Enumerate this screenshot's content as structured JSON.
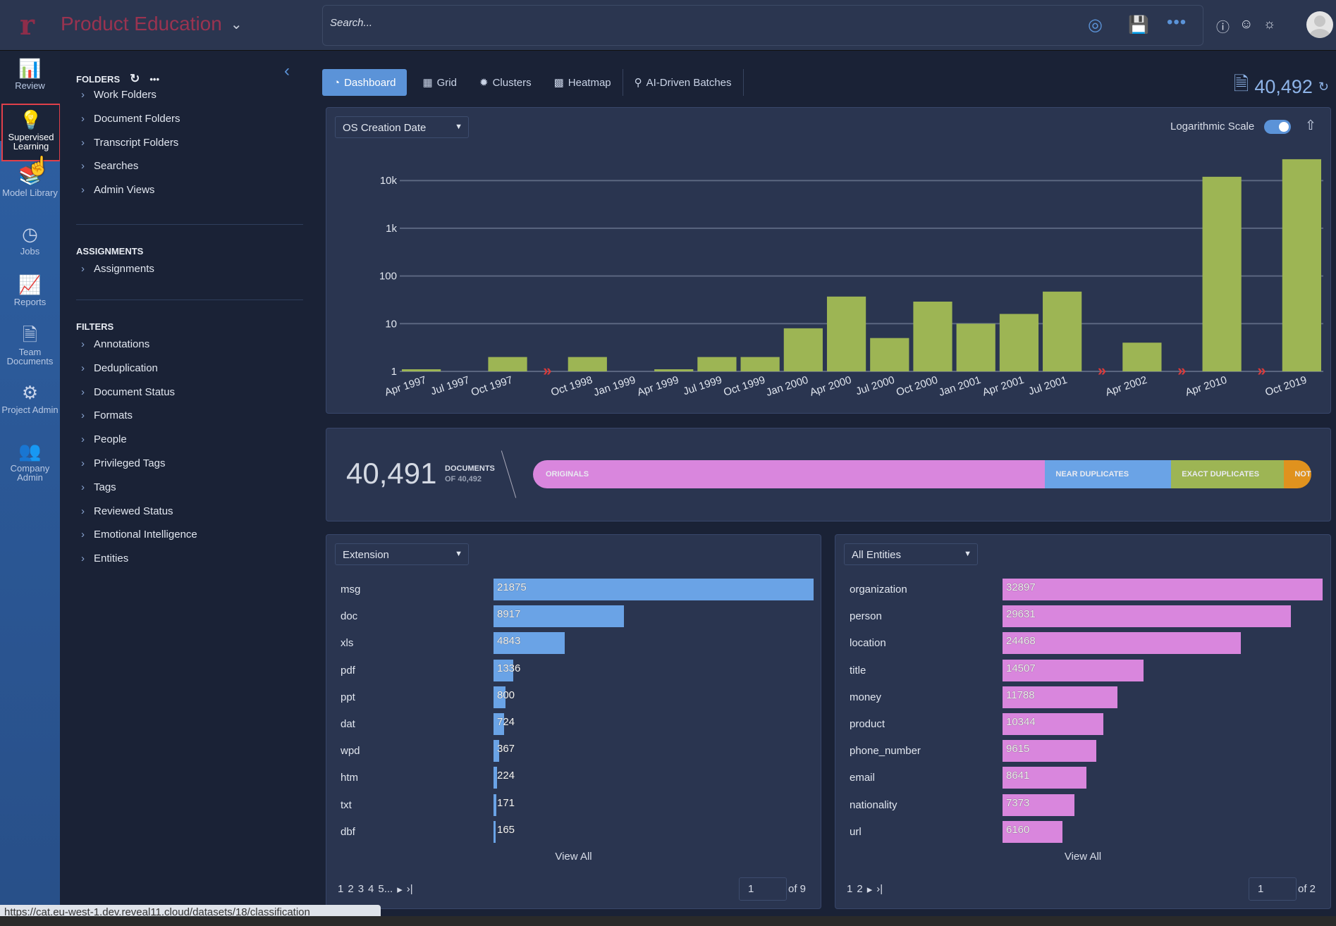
{
  "header": {
    "logo": "r",
    "project": "Product Education",
    "search_placeholder": "Search...",
    "icons": [
      "target-icon",
      "save-icon",
      "more-icon",
      "help-icon",
      "support-icon",
      "brightness-icon",
      "avatar"
    ]
  },
  "rail": [
    {
      "label": "Review",
      "icon": "bar-chart-icon"
    },
    {
      "label": "Supervised Learning",
      "icon": "lightbulb-icon",
      "selected": true
    },
    {
      "label": "Model Library",
      "icon": "library-icon"
    },
    {
      "label": "Jobs",
      "icon": "clock-icon"
    },
    {
      "label": "Reports",
      "icon": "line-chart-icon"
    },
    {
      "label": "Team Documents",
      "icon": "document-icon"
    },
    {
      "label": "Project Admin",
      "icon": "gear-icon"
    },
    {
      "label": "Company Admin",
      "icon": "users-icon"
    }
  ],
  "panel": {
    "folders_title": "FOLDERS",
    "folders": [
      "Work Folders",
      "Document Folders",
      "Transcript Folders",
      "Searches",
      "Admin Views"
    ],
    "assignments_title": "ASSIGNMENTS",
    "assignments": [
      "Assignments"
    ],
    "filters_title": "FILTERS",
    "filters": [
      "Annotations",
      "Deduplication",
      "Document Status",
      "Formats",
      "People",
      "Privileged Tags",
      "Tags",
      "Reviewed Status",
      "Emotional Intelligence",
      "Entities"
    ]
  },
  "tabs": [
    {
      "label": "Dashboard",
      "icon": "gauge-icon",
      "active": true
    },
    {
      "label": "Grid",
      "icon": "grid-icon"
    },
    {
      "label": "Clusters",
      "icon": "clusters-icon"
    },
    {
      "label": "Heatmap",
      "icon": "heatmap-icon"
    },
    {
      "label": "AI-Driven Batches",
      "icon": "bulb-icon"
    }
  ],
  "total_docs": "40,492",
  "timeline": {
    "dropdown": "OS Creation Date",
    "log_label": "Logarithmic Scale",
    "log_enabled": true
  },
  "chart_data": {
    "type": "bar",
    "yscale": "log",
    "ylim": [
      1,
      30000
    ],
    "yticks": [
      "1",
      "10",
      "100",
      "1k",
      "10k"
    ],
    "color": "#9db554",
    "break_color": "#d83a3a",
    "categories": [
      "Apr 1997",
      "Jul 1997",
      "Oct 1997",
      "|",
      "Oct 1998",
      "Jan 1999",
      "Apr 1999",
      "Jul 1999",
      "Oct 1999",
      "Jan 2000",
      "Apr 2000",
      "Jul 2000",
      "Oct 2000",
      "Jan 2001",
      "Apr 2001",
      "Jul 2001",
      "|",
      "Apr 2002",
      "|",
      "Apr 2010",
      "|",
      "Oct 2019"
    ],
    "values": [
      1,
      0,
      2,
      null,
      2,
      0,
      1,
      2,
      2,
      8,
      37,
      5,
      29,
      10,
      16,
      47,
      null,
      4,
      null,
      12000,
      null,
      28000
    ]
  },
  "dedupe": {
    "count": "40,491",
    "label": "DOCUMENTS",
    "of": "OF 40,492",
    "segments": [
      {
        "label": "ORIGINALS",
        "share": 0.648,
        "color": "#d986dd"
      },
      {
        "label": "NEAR DUPLICATES",
        "share": 0.162,
        "color": "#6aa3e6"
      },
      {
        "label": "EXACT DUPLICATES",
        "share": 0.145,
        "color": "#9db554"
      },
      {
        "label": "NOT",
        "share": 0.045,
        "color": "#e0921e"
      }
    ]
  },
  "extension": {
    "dropdown": "Extension",
    "color": "#6aa3e6",
    "max": 21875,
    "rows": [
      {
        "label": "msg",
        "value": 21875
      },
      {
        "label": "doc",
        "value": 8917
      },
      {
        "label": "xls",
        "value": 4843
      },
      {
        "label": "pdf",
        "value": 1336
      },
      {
        "label": "ppt",
        "value": 800
      },
      {
        "label": "dat",
        "value": 724
      },
      {
        "label": "wpd",
        "value": 367
      },
      {
        "label": "htm",
        "value": 224
      },
      {
        "label": "txt",
        "value": 171
      },
      {
        "label": "dbf",
        "value": 165
      }
    ],
    "view_all": "View All",
    "pages": [
      "1",
      "2",
      "3",
      "4",
      "5..."
    ],
    "page": "1",
    "of": "of 9"
  },
  "entities": {
    "dropdown": "All Entities",
    "color": "#d986dd",
    "max": 32897,
    "rows": [
      {
        "label": "organization",
        "value": 32897
      },
      {
        "label": "person",
        "value": 29631
      },
      {
        "label": "location",
        "value": 24468
      },
      {
        "label": "title",
        "value": 14507
      },
      {
        "label": "money",
        "value": 11788
      },
      {
        "label": "product",
        "value": 10344
      },
      {
        "label": "phone_number",
        "value": 9615
      },
      {
        "label": "email",
        "value": 8641
      },
      {
        "label": "nationality",
        "value": 7373
      },
      {
        "label": "url",
        "value": 6160
      }
    ],
    "view_all": "View All",
    "pages": [
      "1",
      "2"
    ],
    "page": "1",
    "of": "of 2"
  },
  "status_url": "https://cat.eu-west-1.dev.reveal11.cloud/datasets/18/classification"
}
